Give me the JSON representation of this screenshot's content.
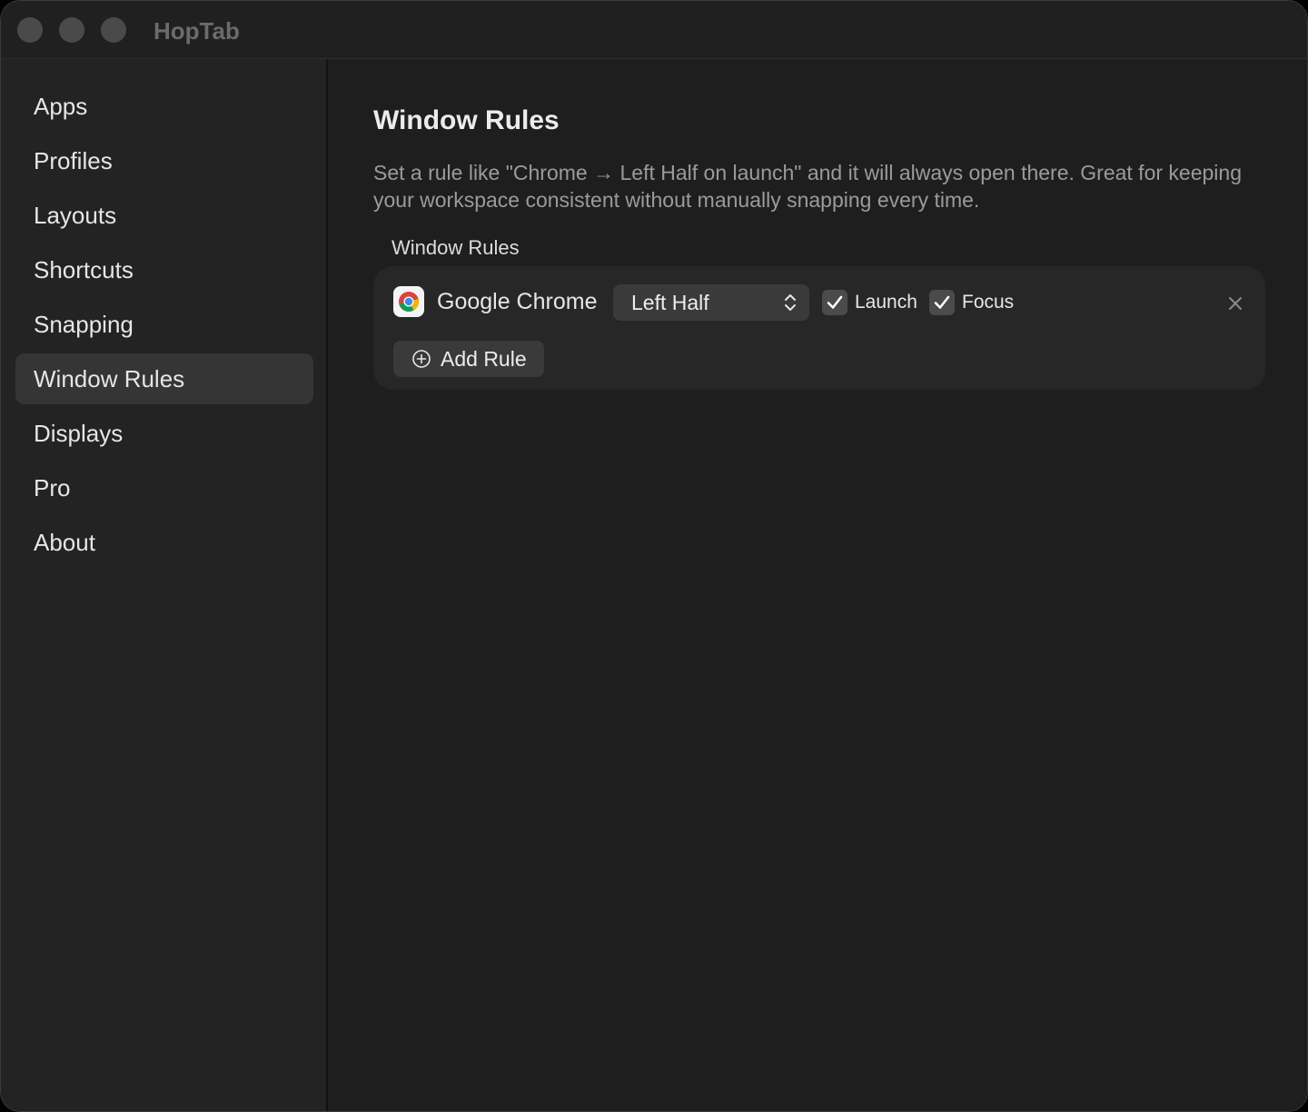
{
  "window": {
    "title": "HopTab"
  },
  "sidebar": {
    "items": [
      {
        "label": "Apps"
      },
      {
        "label": "Profiles"
      },
      {
        "label": "Layouts"
      },
      {
        "label": "Shortcuts"
      },
      {
        "label": "Snapping"
      },
      {
        "label": "Window Rules",
        "selected": true
      },
      {
        "label": "Displays"
      },
      {
        "label": "Pro"
      },
      {
        "label": "About"
      }
    ]
  },
  "main": {
    "title": "Window Rules",
    "description": "Set a rule like \"Chrome → Left Half on launch\" and it will always open there. Great for keeping your workspace consistent without manually snapping every time.",
    "section_label": "Window Rules",
    "rules": [
      {
        "app": "Google Chrome",
        "app_icon": "chrome-icon",
        "position": "Left Half",
        "launch_label": "Launch",
        "launch_checked": true,
        "focus_label": "Focus",
        "focus_checked": true
      }
    ],
    "add_rule_label": "Add Rule"
  },
  "colors": {
    "window_bg": "#1f1f1f",
    "sidebar_bg": "#232323",
    "selected_item_bg": "#353535",
    "card_bg": "#272727",
    "control_bg": "#3a3a3a",
    "text_primary": "#e6e6e6",
    "text_secondary": "#9b9b9b"
  }
}
